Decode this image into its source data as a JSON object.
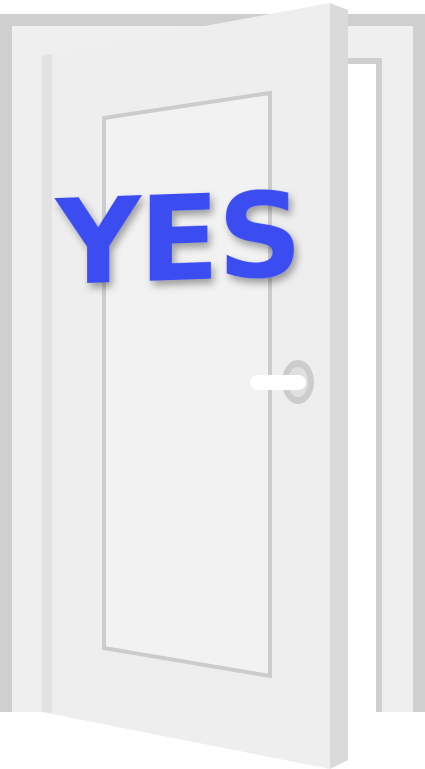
{
  "sign": {
    "text": "YES",
    "text_color": "#3a4ef0"
  },
  "colors": {
    "frame_outer": "#cfcfcf",
    "frame_inner": "#efefef",
    "door_face": "#eeeeee",
    "door_edge": "#dadada",
    "door_opening": "#ffffff",
    "panel_border": "#cccccc",
    "panel_fill": "#f2f2f2",
    "handle_rose": "#cccccc",
    "handle_lever": "#ffffff"
  },
  "icons": [
    "open-door-icon",
    "door-handle-icon"
  ]
}
